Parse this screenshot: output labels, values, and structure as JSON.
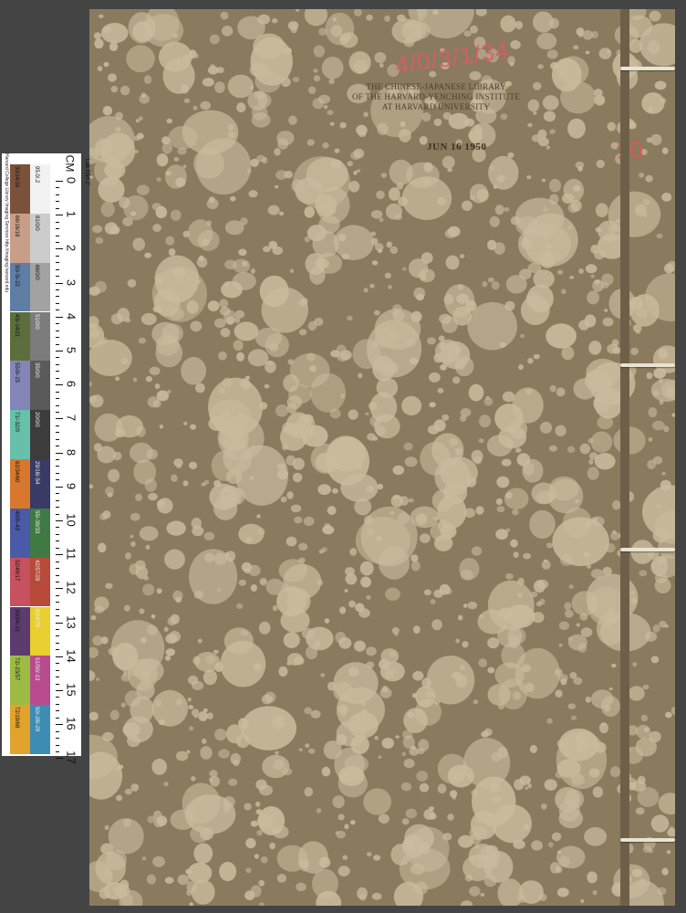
{
  "cover": {
    "stamp_lines": [
      "THE CHINESE-JAPANESE LIBRARY",
      "OF THE HARVARD-YENCHING INSTITUTE",
      "AT HARVARD UNIVERSITY"
    ],
    "stamp_date": "JUN 16 1950",
    "call_number": "4/0/3/1/34",
    "volume_mark": "30"
  },
  "colors": {
    "paper": "#8a7a5e",
    "spot": "#c9bb9c",
    "stamp_red": "#e25a63",
    "thread": "#e9e3d2"
  },
  "ruler": {
    "unit_label": "CM",
    "credit": "Harvard College Library Imaging Services http://imaging.harvard.edu",
    "lab_label": "Lab D50 2˚",
    "gray_first": "95.0/.2",
    "numbers": [
      "0",
      "1",
      "2",
      "3",
      "4",
      "5",
      "6",
      "7",
      "8",
      "9",
      "10",
      "11",
      "12",
      "13",
      "14",
      "15",
      "16",
      "17"
    ],
    "swatches": [
      {
        "color": "#7b5139",
        "label": "30/14/16"
      },
      {
        "color": "#c99e88",
        "label": "66/16/18"
      },
      {
        "color": "#5f7ea5",
        "label": "50/-5/-22"
      },
      {
        "color": "#5b6e3b",
        "label": "43/-14/21"
      },
      {
        "color": "#8486ba",
        "label": "55/9/-25"
      },
      {
        "color": "#66c0aa",
        "label": "71/-32/0"
      },
      {
        "color": "#d7782e",
        "label": "62/34/60"
      },
      {
        "color": "#4a5aa6",
        "label": "40/9/-43"
      },
      {
        "color": "#c6515f",
        "label": "52/48/17"
      },
      {
        "color": "#5c3b6e",
        "label": "30/24/-21"
      },
      {
        "color": "#9cbb44",
        "label": "72/-23/57"
      },
      {
        "color": "#e2a32c",
        "label": "72/19/68"
      }
    ],
    "grays": [
      {
        "color": "#f2f2f2",
        "label": "95.0/.2"
      },
      {
        "color": "#cccccc",
        "label": "81/0/0"
      },
      {
        "color": "#a2a2a2",
        "label": "66/0/0"
      },
      {
        "color": "#7c7c7c",
        "label": "51/0/0"
      },
      {
        "color": "#5a5a5a",
        "label": "35/0/0"
      },
      {
        "color": "#3c3c3c",
        "label": "20/0/0"
      },
      {
        "color": "#3a3a66",
        "label": "29/18/-54"
      },
      {
        "color": "#3f7a45",
        "label": "55/-39/33"
      },
      {
        "color": "#b84a3a",
        "label": "42/57/29"
      },
      {
        "color": "#e9cf2f",
        "label": "82/4/79"
      },
      {
        "color": "#b84b8e",
        "label": "51/50/-13"
      },
      {
        "color": "#3c8cb4",
        "label": "50/-28/-29"
      }
    ]
  }
}
